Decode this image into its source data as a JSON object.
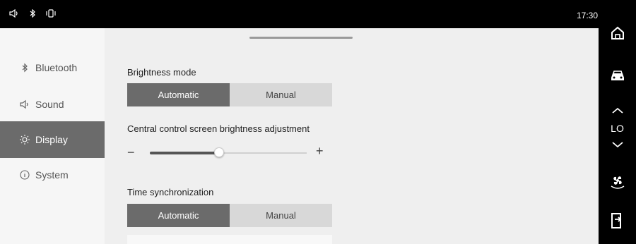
{
  "status_bar": {
    "icons": [
      "volume-icon",
      "bluetooth-icon",
      "vibrate-icon"
    ],
    "clock": "17:30"
  },
  "sidebar": {
    "items": [
      {
        "label": "Bluetooth",
        "icon": "bluetooth-icon",
        "active": false
      },
      {
        "label": "Sound",
        "icon": "speaker-icon",
        "active": false
      },
      {
        "label": "Display",
        "icon": "sun-icon",
        "active": true
      },
      {
        "label": "System",
        "icon": "info-icon",
        "active": false
      }
    ]
  },
  "content": {
    "brightness_mode": {
      "title": "Brightness mode",
      "options": [
        "Automatic",
        "Manual"
      ],
      "selected": "Automatic"
    },
    "brightness_adjust": {
      "title": "Central control screen brightness adjustment",
      "minus": "−",
      "plus": "+",
      "level": 0.44
    },
    "time_sync": {
      "title": "Time synchronization",
      "options": [
        "Automatic",
        "Manual"
      ],
      "selected": "Automatic"
    }
  },
  "dock": {
    "home_icon": "home-icon",
    "car_icon": "car-icon",
    "temp_label": "LO",
    "fan_icon": "fan-icon",
    "door_icon": "door-exit-icon"
  },
  "colors": {
    "selected": "#6b6b6b",
    "unselected": "#d8d8d8",
    "background": "#efefef",
    "bar": "#000000"
  }
}
